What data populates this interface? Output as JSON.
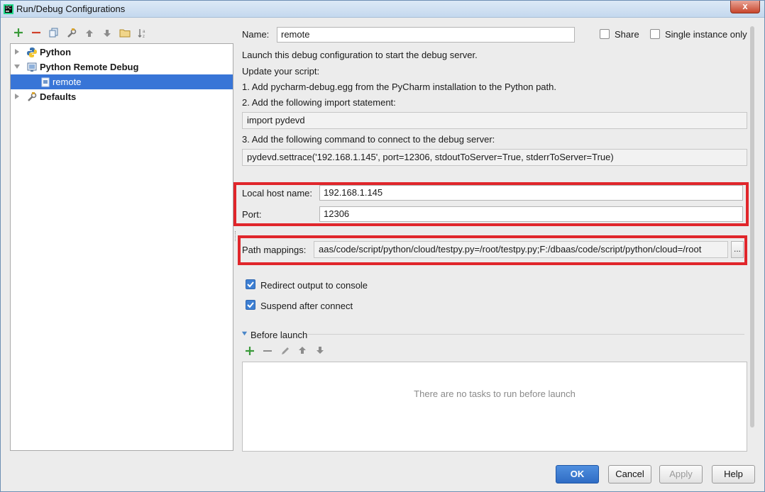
{
  "window": {
    "title": "Run/Debug Configurations",
    "close_glyph": "x"
  },
  "toolbar": {
    "icons": [
      "add-icon",
      "remove-icon",
      "copy-icon",
      "edit-defaults-icon",
      "move-up-icon",
      "move-down-icon",
      "folder-icon",
      "sort-icon"
    ]
  },
  "tree": {
    "items": [
      {
        "label": "Python",
        "level": 0,
        "expanded": false,
        "bold": true,
        "icon": "python-icon"
      },
      {
        "label": "Python Remote Debug",
        "level": 0,
        "expanded": true,
        "bold": true,
        "icon": "remote-debug-icon"
      },
      {
        "label": "remote",
        "level": 1,
        "selected": true,
        "bold": false,
        "icon": "config-icon"
      },
      {
        "label": "Defaults",
        "level": 0,
        "expanded": false,
        "bold": true,
        "icon": "defaults-icon"
      }
    ]
  },
  "form": {
    "name_label": "Name:",
    "name_value": "remote",
    "share_label": "Share",
    "share_checked": false,
    "single_instance_label": "Single instance only",
    "single_instance_checked": false,
    "info_line1": "Launch this debug configuration to start the debug server.",
    "info_line2": "Update your script:",
    "step1": "1. Add pycharm-debug.egg from the PyCharm installation to the Python path.",
    "step2": "2. Add the following import statement:",
    "import_statement": "import pydevd",
    "step3": "3. Add the following command to connect to the debug server:",
    "settrace_command": "pydevd.settrace('192.168.1.145', port=12306, stdoutToServer=True, stderrToServer=True)",
    "local_host_label": "Local host name:",
    "local_host_value": "192.168.1.145",
    "port_label": "Port:",
    "port_value": "12306",
    "path_mappings_label": "Path mappings:",
    "path_mappings_value": "aas/code/script/python/cloud/testpy.py=/root/testpy.py;F:/dbaas/code/script/python/cloud=/root",
    "browse_glyph": "...",
    "redirect_label": "Redirect output to console",
    "redirect_checked": true,
    "suspend_label": "Suspend after connect",
    "suspend_checked": true
  },
  "before_launch": {
    "title": "Before launch",
    "toolbar_icons": [
      "add-task-icon",
      "remove-task-icon",
      "edit-task-icon",
      "task-up-icon",
      "task-down-icon"
    ],
    "empty_text": "There are no tasks to run before launch"
  },
  "buttons": {
    "ok": "OK",
    "cancel": "Cancel",
    "apply": "Apply",
    "help": "Help"
  },
  "colors": {
    "selection": "#3875d7",
    "highlight_box": "#e0262b",
    "primary_button": "#2f6cc4",
    "checkbox_on": "#3d7fd3"
  }
}
